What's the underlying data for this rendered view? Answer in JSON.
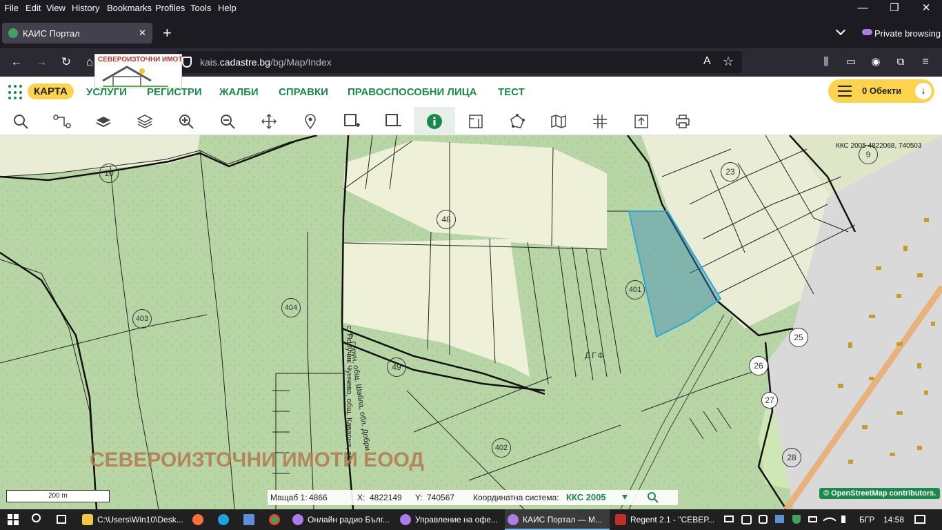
{
  "menu": [
    "File",
    "Edit",
    "View",
    "History",
    "Bookmarks",
    "Profiles",
    "Tools",
    "Help"
  ],
  "window_controls": {
    "minimize": "—",
    "restore": "❐",
    "close": "✕"
  },
  "tab": {
    "title": "КАИС Портал",
    "close": "✕",
    "new": "+"
  },
  "private_label": "Private browsing",
  "url": {
    "domain_pre": "kais.",
    "domain": "cadastre.bg",
    "path": "/bg/Map/Index"
  },
  "overlay_logo_text": "СЕВЕРОИЗТОЧНИ ИМОТИ",
  "site_nav": {
    "links": [
      "КАРТА",
      "УСЛУГИ",
      "РЕГИСТРИ",
      "ЖАЛБИ",
      "СПРАВКИ",
      "ПРАВОСПОСОБНИ ЛИЦА",
      "ТЕСТ"
    ],
    "objects_count": "0 Обекти"
  },
  "tools": [
    "search-icon",
    "route-icon",
    "layer-icon",
    "layers-icon",
    "zoom-in-icon",
    "zoom-out-icon",
    "pan-icon",
    "marker-icon",
    "select-add-icon",
    "select-remove-icon",
    "info-icon",
    "measure-icon",
    "polygon-icon",
    "map-icon",
    "grid-icon",
    "export-icon",
    "print-icon"
  ],
  "map": {
    "coords_readout": "ККС 2005 4822068, 740503",
    "parcel_labels": [
      "9",
      "10",
      "23",
      "48",
      "401",
      "403",
      "404",
      "49",
      "402",
      "25",
      "26",
      "27",
      "28"
    ],
    "dgf_label": "ДГФ",
    "watermark": "СЕВЕРОИЗТОЧНИ ИМОТИ ЕООД",
    "road_text_1": "с. Поручик Чунчево, общ. Каварна, обл.",
    "road_text_2": "с. Горун, общ. Шабла, обл. Добри",
    "scale_label": "200 m",
    "osm_credit": "© OpenStreetMap contributors."
  },
  "status": {
    "scale_label": "Мащаб 1:",
    "scale_value": "4866",
    "x_label": "X:",
    "x_value": "4822149",
    "y_label": "Y:",
    "y_value": "740567",
    "crs_label": "Координатна система:",
    "crs_value": "ККС 2005"
  },
  "taskbar": {
    "items": [
      "C:\\Users\\Win10\\Desk...",
      "Онлайн радио Бълг...",
      "Управление на офе...",
      "КАИС Портал — M...",
      "Regent 2.1 - \"СЕВЕР..."
    ],
    "lang": "БГР",
    "time": "14:58"
  },
  "colors": {
    "accent_green": "#1a8a4a",
    "yellow": "#fcd34d",
    "parcel_highlight": "#2aa8d8"
  }
}
